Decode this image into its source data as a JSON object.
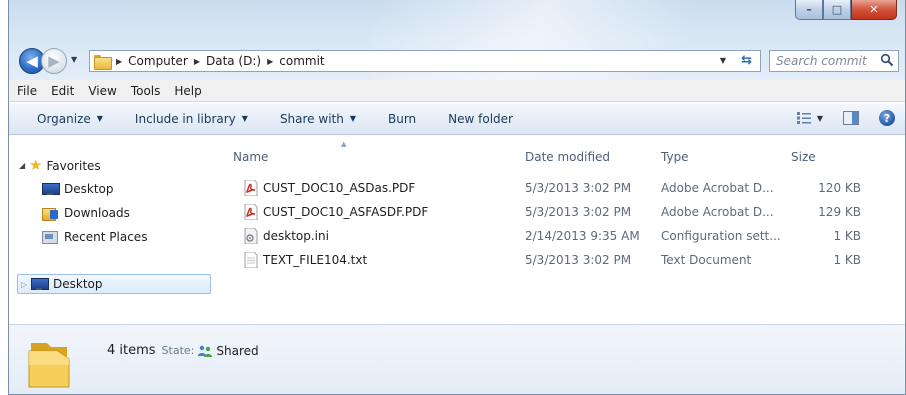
{
  "window": {
    "caption": {
      "minimize": "–",
      "maximize": "□",
      "close": "✕"
    }
  },
  "navigation": {
    "back_icon": "back-arrow-icon",
    "forward_icon": "forward-arrow-icon"
  },
  "address": {
    "crumbs": [
      "Computer",
      "Data (D:)",
      "commit"
    ]
  },
  "search": {
    "placeholder": "Search commit"
  },
  "menu": [
    "File",
    "Edit",
    "View",
    "Tools",
    "Help"
  ],
  "commands": {
    "organize": "Organize",
    "include_in_library": "Include in library",
    "share_with": "Share with",
    "burn": "Burn",
    "new_folder": "New folder"
  },
  "nav_pane": {
    "favorites": "Favorites",
    "items": [
      "Desktop",
      "Downloads",
      "Recent Places"
    ],
    "desktop_root": "Desktop"
  },
  "columns": {
    "name": "Name",
    "date_modified": "Date modified",
    "type": "Type",
    "size": "Size"
  },
  "files": [
    {
      "name": "CUST_DOC10_ASDas.PDF",
      "date": "5/3/2013 3:02 PM",
      "type": "Adobe Acrobat D...",
      "size": "120 KB",
      "icon": "pdf-icon"
    },
    {
      "name": "CUST_DOC10_ASFASDF.PDF",
      "date": "5/3/2013 3:02 PM",
      "type": "Adobe Acrobat D...",
      "size": "129 KB",
      "icon": "pdf-icon"
    },
    {
      "name": "desktop.ini",
      "date": "2/14/2013 9:35 AM",
      "type": "Configuration sett...",
      "size": "1 KB",
      "icon": "ini-file-icon"
    },
    {
      "name": "TEXT_FILE104.txt",
      "date": "5/3/2013 3:02 PM",
      "type": "Text Document",
      "size": "1 KB",
      "icon": "text-file-icon"
    }
  ],
  "details": {
    "count": "4 items",
    "state_label": "State:",
    "state_value": "Shared"
  },
  "colors": {
    "accent": "#2f6fc6",
    "close_red": "#c0331c",
    "pdf_red": "#c8251b",
    "folder_yellow": "#e9b83b"
  }
}
